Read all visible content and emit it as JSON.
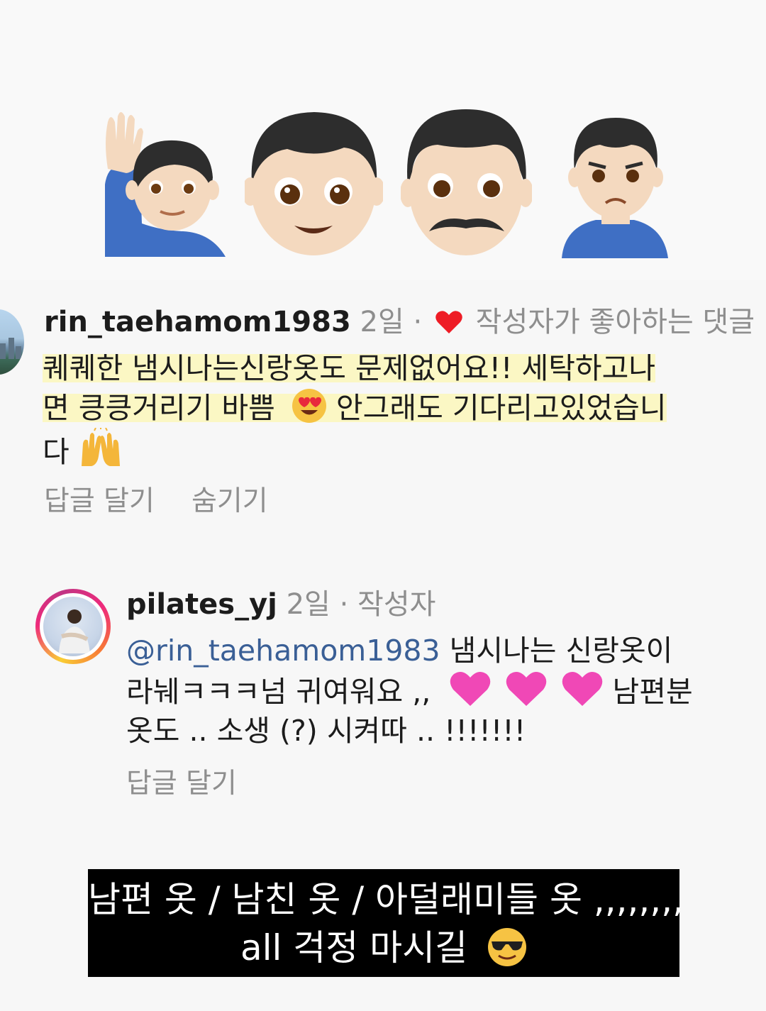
{
  "emoji_banner": {
    "icons": [
      "man-raising-hand-emoji",
      "boy-emoji",
      "man-emoji",
      "man-pouting-emoji"
    ]
  },
  "comment1": {
    "username": "rin_taehamom1983",
    "age": "2일",
    "separator": "·",
    "liked_label": "작성자가 좋아하는 댓글",
    "text_line1": "퀘퀘한 냄시나는신랑옷도 문제없어요!! 세탁하고나",
    "text_line2a": "면 킁킁거리기 바쁨",
    "text_line2b": " 안그래도 기다리고있었습니",
    "text_line3": "다",
    "reply_label": "답글 달기",
    "hide_label": "숨기기"
  },
  "comment2": {
    "username": "pilates_yj",
    "age": "2일",
    "separator": "·",
    "author_label": "작성자",
    "mention": "@rin_taehamom1983",
    "text_line1": " 냄시나는 신랑옷이",
    "text_line2a": "라눼ㅋㅋㅋ넘 귀여워요 ,,",
    "text_line2b": " 남편분",
    "text_line3": "옷도 .. 소생 (?) 시켜따 .. !!!!!!!",
    "reply_label": "답글 달기"
  },
  "caption": {
    "line1": "남편 옷 / 남친 옷 / 아덜래미들 옷 ,,,,,,,,",
    "line2": "all 걱정 마시길"
  },
  "colors": {
    "heart": "#ee1c25",
    "highlight": "#fbf7c4",
    "mention": "#3a5f96",
    "meta_gray": "#8e8e8e",
    "pink_heart": "#f048b6"
  }
}
